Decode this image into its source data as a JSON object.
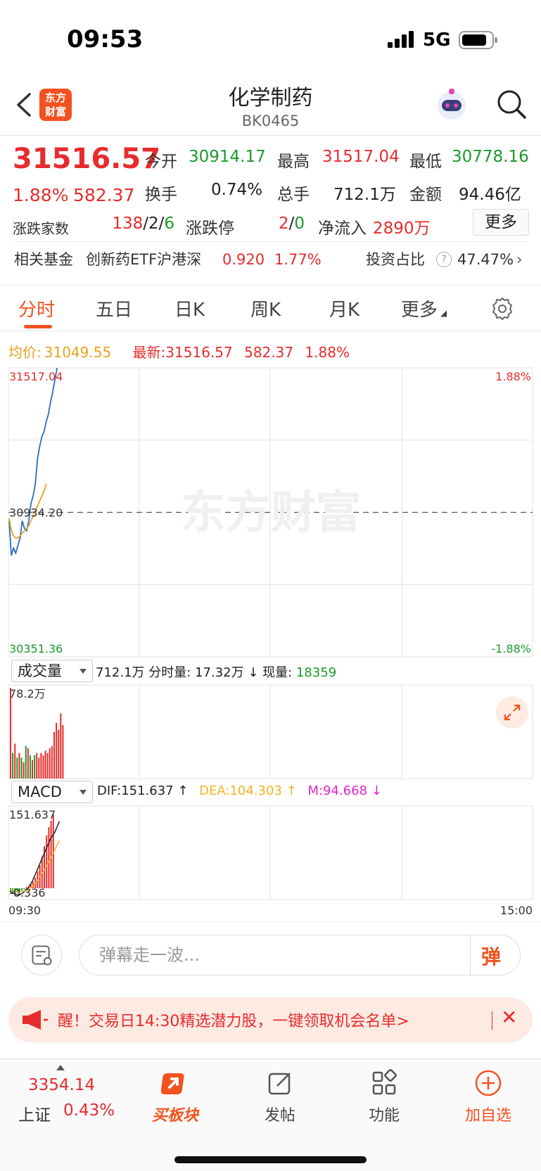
{
  "status_bar": {
    "time": "09:53",
    "network": "5G"
  },
  "header": {
    "brand_logo_text": "东方\n财富",
    "title": "化学制药",
    "code": "BK0465"
  },
  "quote": {
    "last_price": "31516.57",
    "change_pct": "1.88%",
    "change_amt": "582.37",
    "open_label": "今开",
    "open": "30914.17",
    "high_label": "最高",
    "high": "31517.04",
    "low_label": "最低",
    "low": "30778.16",
    "turnover_label": "换手",
    "turnover": "0.74%",
    "volume_label": "总手",
    "volume": "712.1万",
    "amount_label": "金额",
    "amount": "94.46亿",
    "updown_label": "涨跌家数",
    "updown_up": "138",
    "updown_flat": "2",
    "updown_down": "6",
    "limit_label": "涨跌停",
    "limit_up": "2",
    "limit_down": "0",
    "netflow_label": "净流入",
    "netflow": "2890万",
    "more_label": "更多"
  },
  "fund": {
    "label": "相关基金",
    "name": "创新药ETF沪港深",
    "price": "0.920",
    "pct": "1.77%",
    "invest_label": "投资占比",
    "invest_val": "47.47%"
  },
  "tabs": [
    "分时",
    "五日",
    "日K",
    "周K",
    "月K",
    "更多"
  ],
  "info_line": {
    "avg_label": "均价:",
    "avg_val": "31049.55",
    "latest_label": "最新:",
    "latest_val": "31516.57",
    "latest_chg": "582.37",
    "latest_pct": "1.88%"
  },
  "chart_data": {
    "type": "line",
    "title": "",
    "xlabel": "",
    "ylabel": "",
    "x_ticks": [
      "09:30",
      "15:00"
    ],
    "y_left_ticks": [
      "31517.04",
      "30934.20",
      "30351.36"
    ],
    "y_right_ticks": [
      "1.88%",
      "-1.88%"
    ],
    "ylim": [
      30351.36,
      31517.04
    ],
    "prev_close": 30934.2,
    "watermark": "东方财富",
    "series": [
      {
        "values": [
          30900,
          30760,
          30790,
          30770,
          30800,
          30830,
          30900,
          30870,
          30860,
          30900,
          30970,
          31000,
          31050,
          31150,
          31200,
          31240,
          31260,
          31300,
          31330,
          31380,
          31420,
          31470,
          31517
        ]
      },
      {
        "values": [
          30910,
          30860,
          30840,
          30830,
          30830,
          30840,
          30850,
          30860,
          30870,
          30880,
          30900,
          30920,
          30940,
          30960,
          30980,
          31000,
          31020,
          31049
        ]
      }
    ]
  },
  "volume_panel": {
    "selector": "成交量",
    "total": "712.1万",
    "minute_label": "分时量:",
    "minute_val": "17.32万",
    "arrow": "↓",
    "now_label": "现量:",
    "now_val": "18359",
    "max_label": "78.2万",
    "bars": [
      78,
      22,
      30,
      18,
      22,
      18,
      14,
      28,
      26,
      20,
      16,
      20,
      22,
      18,
      22,
      20,
      24,
      22,
      26,
      28,
      40,
      48,
      42,
      56,
      46
    ]
  },
  "macd_panel": {
    "selector": "MACD",
    "dif": "DIF:151.637 ↑",
    "dea": "DEA:104.303 ↑",
    "m": "M:94.668 ↓",
    "max_label": "151.637",
    "min_label": "-0.336",
    "colors": {
      "dif": "#222222",
      "dea": "#f4b321",
      "m": "#e024c8"
    }
  },
  "comment_bar": {
    "placeholder": "弹幕走一波...",
    "button": "弹"
  },
  "promo": {
    "text": "醒！交易日14:30精选潜力股，一键领取机会名单>"
  },
  "bottom_nav": {
    "index_value": "3354.14",
    "index_name": "上证",
    "index_pct": "0.43%",
    "items": [
      "买板块",
      "发帖",
      "功能",
      "加自选"
    ]
  },
  "colors": {
    "up": "#e62c2c",
    "down": "#1a9a2a",
    "accent": "#f3521f",
    "avg": "#e7a31a",
    "price_line": "#2b6cc4"
  }
}
